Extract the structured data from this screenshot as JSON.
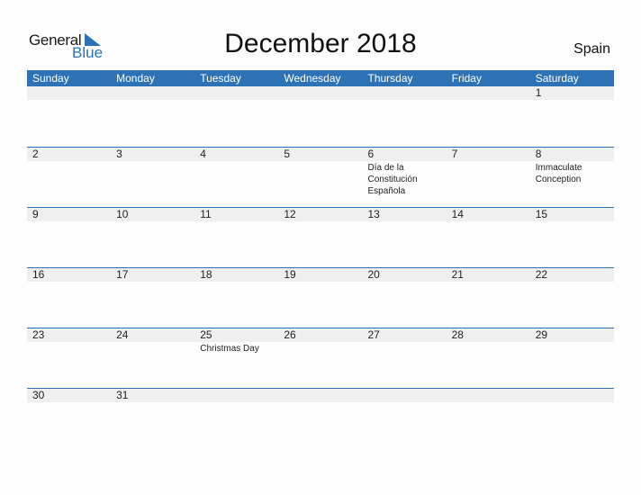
{
  "logo": {
    "general": "General",
    "blue": "Blue",
    "accent": "#2a72b5"
  },
  "title": "December 2018",
  "country": "Spain",
  "colors": {
    "header_bg": "#2d72b5",
    "band_bg": "#efefef"
  },
  "weekdays": [
    "Sunday",
    "Monday",
    "Tuesday",
    "Wednesday",
    "Thursday",
    "Friday",
    "Saturday"
  ],
  "weeks": [
    [
      {
        "d": ""
      },
      {
        "d": ""
      },
      {
        "d": ""
      },
      {
        "d": ""
      },
      {
        "d": ""
      },
      {
        "d": ""
      },
      {
        "d": "1"
      }
    ],
    [
      {
        "d": "2"
      },
      {
        "d": "3"
      },
      {
        "d": "4"
      },
      {
        "d": "5"
      },
      {
        "d": "6",
        "h": "Día de la Constitución Española"
      },
      {
        "d": "7"
      },
      {
        "d": "8",
        "h": "Immaculate Conception"
      }
    ],
    [
      {
        "d": "9"
      },
      {
        "d": "10"
      },
      {
        "d": "11"
      },
      {
        "d": "12"
      },
      {
        "d": "13"
      },
      {
        "d": "14"
      },
      {
        "d": "15"
      }
    ],
    [
      {
        "d": "16"
      },
      {
        "d": "17"
      },
      {
        "d": "18"
      },
      {
        "d": "19"
      },
      {
        "d": "20"
      },
      {
        "d": "21"
      },
      {
        "d": "22"
      }
    ],
    [
      {
        "d": "23"
      },
      {
        "d": "24"
      },
      {
        "d": "25",
        "h": "Christmas Day"
      },
      {
        "d": "26"
      },
      {
        "d": "27"
      },
      {
        "d": "28"
      },
      {
        "d": "29"
      }
    ],
    [
      {
        "d": "30"
      },
      {
        "d": "31"
      },
      {
        "d": ""
      },
      {
        "d": ""
      },
      {
        "d": ""
      },
      {
        "d": ""
      },
      {
        "d": ""
      }
    ]
  ]
}
